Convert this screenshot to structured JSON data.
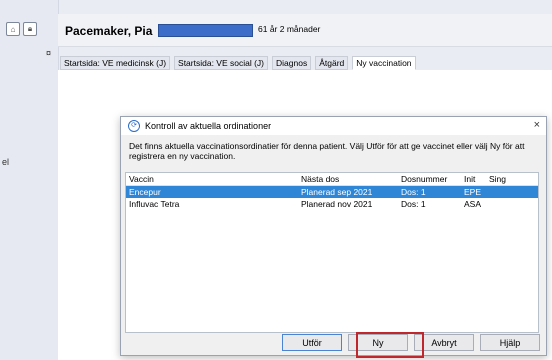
{
  "header": {
    "patient_name": "Pacemaker, Pia",
    "age": "61 år 2 månader",
    "id_bar_color": "#3c6dc8"
  },
  "left": {
    "label": "el"
  },
  "tabs": [
    {
      "label": "Startsida: VE medicinsk (J)"
    },
    {
      "label": "Startsida: VE social (J)"
    },
    {
      "label": "Diagnos"
    },
    {
      "label": "Åtgärd"
    },
    {
      "label": "Ny vaccination",
      "active": true
    }
  ],
  "dialog": {
    "title": "Kontroll av aktuella ordinationer",
    "message": "Det finns aktuella vaccinationsordinatier för denna patient. Välj Utför för att ge vaccinet eller välj Ny för att registrera en ny vaccination.",
    "columns": {
      "vaccine": "Vaccin",
      "next_dose": "Nästa dos",
      "dose_number": "Dosnummer",
      "init": "Init",
      "sign": "Sing"
    },
    "rows": [
      {
        "vaccine": "Encepur",
        "next_dose": "Planerad sep 2021",
        "dose_number": "Dos: 1",
        "init": "EPE",
        "sign": "",
        "selected": true
      },
      {
        "vaccine": "Influvac Tetra",
        "next_dose": "Planerad nov 2021",
        "dose_number": "Dos: 1",
        "init": "ASA",
        "sign": ""
      }
    ],
    "buttons": {
      "execute": "Utför",
      "new": "Ny",
      "cancel": "Avbryt",
      "help": "Hjälp"
    },
    "close_glyph": "×",
    "icon_glyph": "⟳",
    "highlight_color": "#c0272d",
    "selected_row_color": "#2f86d6"
  }
}
